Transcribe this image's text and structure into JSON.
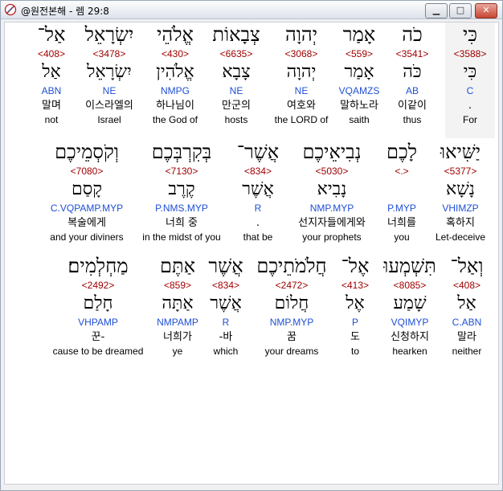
{
  "window": {
    "title": "@원전본해 - 렘 29:8",
    "minimize_label": "▁",
    "maximize_label": "□",
    "close_label": "✕"
  },
  "verse": {
    "rows": [
      {
        "words": [
          {
            "hebrew": "כִּי",
            "strong": "<3588>",
            "lemma": "כִּי",
            "morph": "C",
            "korean": ".",
            "english": "For"
          },
          {
            "hebrew": "כֹה",
            "strong": "<3541>",
            "lemma": "כֹּה",
            "morph": "AB",
            "korean": "이같이",
            "english": "thus"
          },
          {
            "hebrew": "אָמַר",
            "strong": "<559>",
            "lemma": "אָמַר",
            "morph": "VQAMZS",
            "korean": "말하노라",
            "english": "saith"
          },
          {
            "hebrew": "יְהוָה",
            "strong": "<3068>",
            "lemma": "יְהוָה",
            "morph": "NE",
            "korean": "여호와",
            "english": "the LORD of"
          },
          {
            "hebrew": "צְבָאוֹת",
            "strong": "<6635>",
            "lemma": "צָבָא",
            "morph": "NE",
            "korean": "만군의",
            "english": "hosts"
          },
          {
            "hebrew": "אֱלֹהֵי",
            "strong": "<430>",
            "lemma": "אֱלֹהִין",
            "morph": "NMPG",
            "korean": "하나님이",
            "english": "the God of"
          },
          {
            "hebrew": "יִשְׂרָאֵל",
            "strong": "<3478>",
            "lemma": "יִשְׂרָאֵל",
            "morph": "NE",
            "korean": "이스라엘의",
            "english": "Israel"
          },
          {
            "hebrew": "אַל־",
            "strong": "<408>",
            "lemma": "אַל",
            "morph": "ABN",
            "korean": "말며",
            "english": "not"
          }
        ]
      },
      {
        "words": [
          {
            "hebrew": "יַשִּׁיאוּ",
            "strong": "<5377>",
            "lemma": "נָשָׁא",
            "morph": "VHIMZP",
            "korean": "혹하지",
            "english": "Let-deceive"
          },
          {
            "hebrew": "לָכֶם",
            "strong": "<.>",
            "lemma": "",
            "morph": "P.MYP",
            "korean": "너희를",
            "english": "you"
          },
          {
            "hebrew": "נְבִיאֵיכֶם",
            "strong": "<5030>",
            "lemma": "נָבִיא",
            "morph": "NMP.MYP",
            "korean": "선지자들에게와",
            "english": "your prophets"
          },
          {
            "hebrew": "אֲשֶׁר־",
            "strong": "<834>",
            "lemma": "אֲשֶׁר",
            "morph": "R",
            "korean": ".",
            "english": "that be"
          },
          {
            "hebrew": "בְּקִרְבְּכֶם",
            "strong": "<7130>",
            "lemma": "קֶרֶב",
            "morph": "P.NMS.MYP",
            "korean": "너희 중",
            "english": "in the midst of you"
          },
          {
            "hebrew": "וְקֹסְמֵיכֶם",
            "strong": "<7080>",
            "lemma": "קָסַם",
            "morph": "C.VQPAMP.MYP",
            "korean": "복술에게",
            "english": "and your diviners"
          }
        ]
      },
      {
        "words": [
          {
            "hebrew": "וְאַל־",
            "strong": "<408>",
            "lemma": "אַל",
            "morph": "C.ABN",
            "korean": "말라",
            "english": "neither"
          },
          {
            "hebrew": "תִּשְׁמְעוּ",
            "strong": "<8085>",
            "lemma": "שָׁמַע",
            "morph": "VQIMYP",
            "korean": "신청하지",
            "english": "hearken"
          },
          {
            "hebrew": "אֶל־",
            "strong": "<413>",
            "lemma": "אֶל",
            "morph": "P",
            "korean": "도",
            "english": "to"
          },
          {
            "hebrew": "חֲלֹמֹתֵיכֶם",
            "strong": "<2472>",
            "lemma": "חֲלוֹם",
            "morph": "NMP.MYP",
            "korean": "꿈",
            "english": "your dreams"
          },
          {
            "hebrew": "אֲשֶׁר",
            "strong": "<834>",
            "lemma": "אֲשֶׁר",
            "morph": "R",
            "korean": "-바",
            "english": "which"
          },
          {
            "hebrew": "אַתֶּם",
            "strong": "<859>",
            "lemma": "אַתָּה",
            "morph": "NMPAMP",
            "korean": "너희가",
            "english": "ye"
          },
          {
            "hebrew": "מַחְלְמִים׃",
            "strong": "<2492>",
            "lemma": "חָלַם",
            "morph": "VHPAMP",
            "korean": "꾼-",
            "english": "cause to be dreamed"
          }
        ]
      }
    ]
  },
  "colors": {
    "strong": "#a00000",
    "morph": "#1f4fd6",
    "highlight": "#f3f3f3"
  }
}
